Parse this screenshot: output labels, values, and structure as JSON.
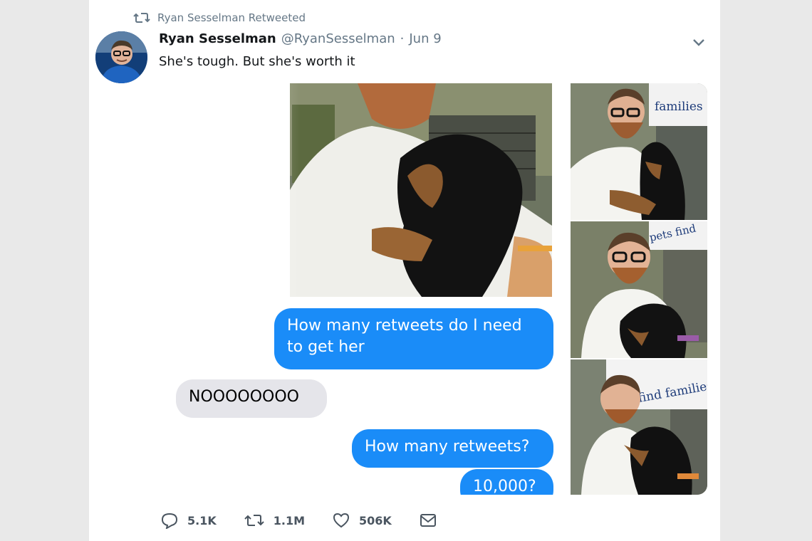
{
  "retweet_context": {
    "text": "Ryan Sesselman Retweeted",
    "icon": "retweet-icon"
  },
  "tweet": {
    "author_name": "Ryan Sesselman",
    "handle": "@RyanSesselman",
    "separator": "·",
    "date": "Jun 9",
    "text": "She's tough. But she's worth it"
  },
  "screenshot_messages": [
    {
      "from": "me",
      "text_line1": "How many retweets do I need",
      "text_line2": "to get her"
    },
    {
      "from": "them",
      "text": "NOOOOOOOO"
    },
    {
      "from": "me",
      "text": "How many retweets?"
    },
    {
      "from": "me",
      "text": "10,000?"
    }
  ],
  "photo_sign_texts": [
    "families",
    "pets find",
    "find families"
  ],
  "actions": {
    "replies": "5.1K",
    "retweets": "1.1M",
    "likes": "506K"
  },
  "colors": {
    "imessage_blue": "#1a8cf8",
    "imessage_grey": "#e5e5ea",
    "secondary_text": "#657786"
  }
}
